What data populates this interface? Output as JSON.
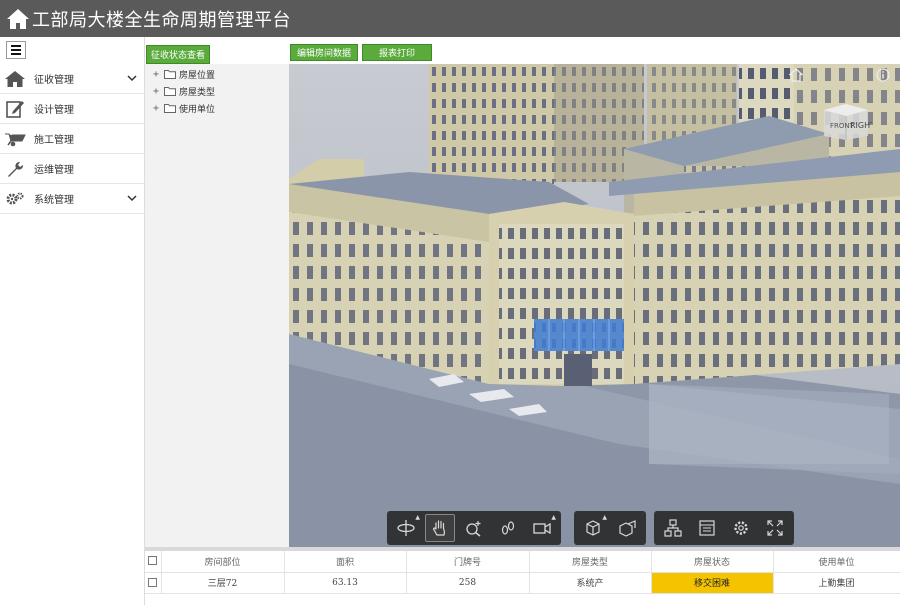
{
  "app": {
    "title": "工部局大楼全生命周期管理平台"
  },
  "sidebar": {
    "items": [
      {
        "label": "征收管理",
        "icon": "house-icon",
        "expandable": true
      },
      {
        "label": "设计管理",
        "icon": "edit-icon",
        "expandable": false
      },
      {
        "label": "施工管理",
        "icon": "wheelbarrow-icon",
        "expandable": false
      },
      {
        "label": "运维管理",
        "icon": "wrench-icon",
        "expandable": false
      },
      {
        "label": "系统管理",
        "icon": "gears-icon",
        "expandable": true
      }
    ]
  },
  "tree": {
    "tab": "征收状态查看",
    "nodes": [
      {
        "label": "房屋位置"
      },
      {
        "label": "房屋类型"
      },
      {
        "label": "使用单位"
      }
    ]
  },
  "toolbar": {
    "edit_label": "编辑房间数据",
    "print_label": "报表打印"
  },
  "viewer": {
    "cube_labels": [
      "RIGHT",
      "FRONT"
    ],
    "tools": [
      "orbit-icon",
      "pan-icon",
      "zoom-icon",
      "walk-icon",
      "camera-icon",
      "explode-icon",
      "section-icon",
      "model-tree-icon",
      "properties-icon",
      "settings-icon",
      "fullscreen-icon"
    ]
  },
  "table": {
    "headers": [
      "房间部位",
      "面积",
      "门牌号",
      "房屋类型",
      "房屋状态",
      "使用单位"
    ],
    "rows": [
      [
        "三层72",
        "63.13",
        "258",
        "系统产",
        "移交困难",
        "上勤集团"
      ]
    ]
  },
  "colors": {
    "accent_green": "#5aab3c",
    "header_gray": "#5a5a5a",
    "status_yellow": "#f5c400"
  }
}
